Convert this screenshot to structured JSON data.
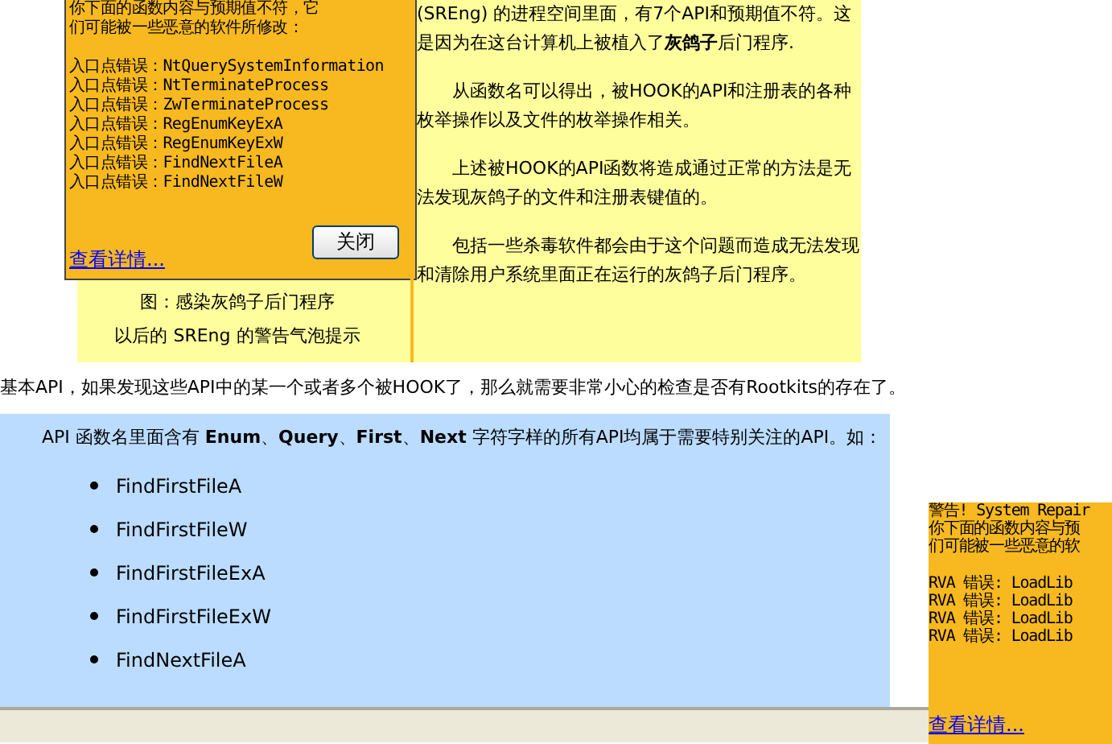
{
  "warning_popup": {
    "lines": [
      "你下面的函数内容与预期值不符，它",
      "们可能被一些恶意的软件所修改："
    ],
    "entries": [
      "入口点错误：NtQuerySystemInformation",
      "入口点错误：NtTerminateProcess",
      "入口点错误：ZwTerminateProcess",
      "入口点错误：RegEnumKeyExA",
      "入口点错误：RegEnumKeyExW",
      "入口点错误：FindNextFileA",
      "入口点错误：FindNextFileW"
    ],
    "details_link": "查看详情...",
    "close_button": "关闭"
  },
  "caption": [
    "图：感染灰鸽子后门程序",
    "以后的 SREng 的警告气泡提示"
  ],
  "paragraphs": [
    "(SREng) 的进程空间里面，有7个API和预期值不符。这是因为在这台计算机上被植入了**灰鸽子**后门程序.",
    "从函数名可以得出，被HOOK的API和注册表的各种枚举操作以及文件的枚举操作相关。",
    "上述被HOOK的API函数将造成通过正常的方法是无法发现灰鸽子的文件和注册表键值的。",
    "包括一些杀毒软件都会由于这个问题而造成无法发现和清除用户系统里面正在运行的灰鸽子后门程序。"
  ],
  "summary": "基本API，如果发现这些API中的某一个或者多个被HOOK了，那么就需要非常小心的检查是否有Rootkits的存在了。",
  "note": {
    "text": "API 函数名里面含有 **Enum**、**Query**、**First**、**Next** 字符字样的所有API均属于需要特别关注的API。如：",
    "items": [
      "FindFirstFileA",
      "FindFirstFileW",
      "FindFirstFileExA",
      "FindFirstFileExW",
      "FindNextFileA"
    ]
  },
  "second_popup": {
    "lines": [
      "警告! System Repair",
      "你下面的函数内容与预",
      "们可能被一些恶意的软"
    ],
    "entries": [
      "RVA 错误: LoadLib",
      "RVA 错误: LoadLib",
      "RVA 错误: LoadLib",
      "RVA 错误: LoadLib"
    ],
    "details_link": "查看详情..."
  }
}
